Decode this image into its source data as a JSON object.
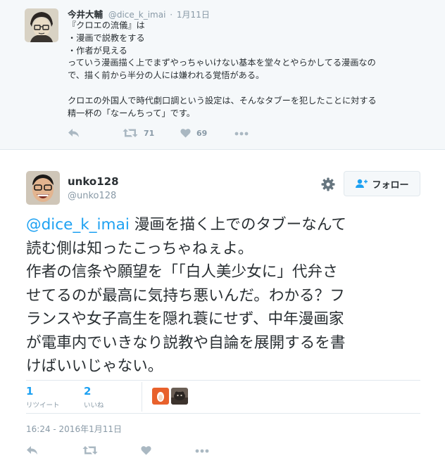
{
  "parent_tweet": {
    "name": "今井大輔",
    "handle": "@dice_k_imai",
    "separator": "·",
    "date": "1月11日",
    "lines": [
      "『クロエの流儀』は",
      "・漫画で説教をする",
      "・作者が見える",
      "っていう漫画描く上でまずやっちゃいけない基本を堂々とやらかしてる漫画なの",
      "で、描く前から半分の人には嫌われる覚悟がある。",
      "",
      "クロエの外国人で時代劇口調という設定は、そんなタブーを犯したことに対する",
      "精一杯の「なーんちって」です。"
    ],
    "retweet_count": "71",
    "like_count": "69"
  },
  "main_tweet": {
    "name": "unko128",
    "handle": "@unko128",
    "follow_label": "フォロー",
    "mention": "@dice_k_imai",
    "lines": [
      " 漫画を描く上でのタブーなんて",
      "読む側は知ったこっちゃねぇよ。",
      "作者の信条や願望を「「白人美少女に」代弁さ",
      "せてるのが最高に気持ち悪いんだ。わかる？フ",
      "ランスや女子高生を隠れ蓑にせず、中年漫画家",
      "が電車内でいきなり説教や自論を展開するを書",
      "けばいいじゃない。"
    ],
    "retweets_num": "1",
    "retweets_label": "リツイート",
    "likes_num": "2",
    "likes_label": "いいね",
    "timestamp": "16:24 - 2016年1月11日"
  },
  "colors": {
    "accent": "#1da1f2",
    "muted": "#8899a6",
    "text": "#292f33",
    "icon": "#aab8c2",
    "border": "#e1e8ed",
    "parent_bg": "#f5f8fa"
  },
  "icons": {
    "reply": "reply-icon",
    "retweet": "retweet-icon",
    "like": "heart-icon",
    "more": "more-icon",
    "settings": "gear-icon",
    "follow": "add-user-icon"
  }
}
